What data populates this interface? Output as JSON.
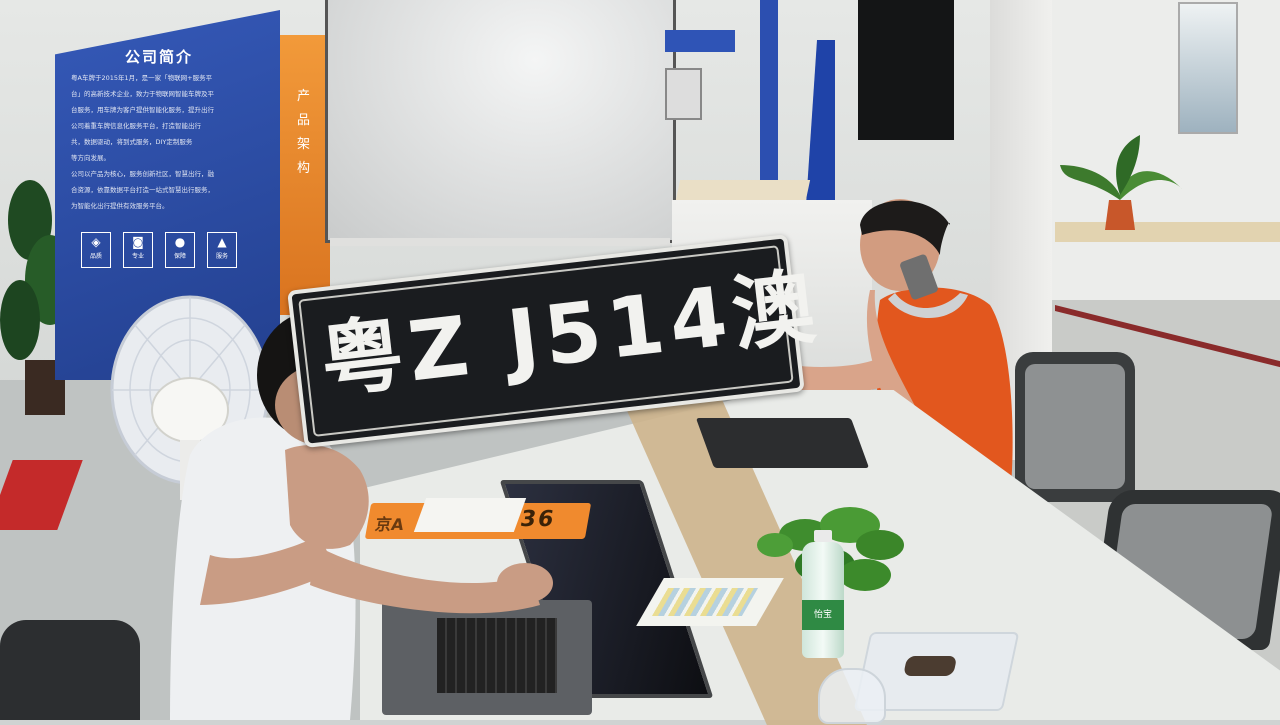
{
  "scene": {
    "wall_board": {
      "title": "公司简介",
      "paragraph": [
        "粤A车牌于2015年1月，是一家「物联网+服务平",
        "台」的高新技术企业，致力于物联网智能车牌及平",
        "台服务，用车牌为客户提供智能化服务，提升出行",
        "公司着重车牌信息化服务平台，打造智能出行",
        "共，数据驱动，将到式服务，DIY定制服务",
        "等方向发展。",
        "公司以产品为核心，服务创新社区，智慧出行，融",
        "合资源，依靠数据平台打造一站式智慧出行服务，",
        "为智能化出行提供有效服务平台。"
      ],
      "icon_captions": [
        "品质",
        "专业",
        "保障",
        "服务"
      ]
    },
    "side_banner": {
      "text": "产品架构"
    },
    "plate_held": {
      "text": "粤Z J514澳"
    },
    "plate_on_table": {
      "text_prefix": "京A",
      "text_digits": "236"
    },
    "bottle_label": "怡宝",
    "colors": {
      "board_blue": "#2a4aa6",
      "banner_orange": "#e8862c",
      "plate_black": "#1a1c1f",
      "plate_white": "#f2f2ef",
      "shirt_orange": "#e2571e",
      "carpet_red": "#c42a2a",
      "table_white": "#e9ebe8"
    }
  }
}
